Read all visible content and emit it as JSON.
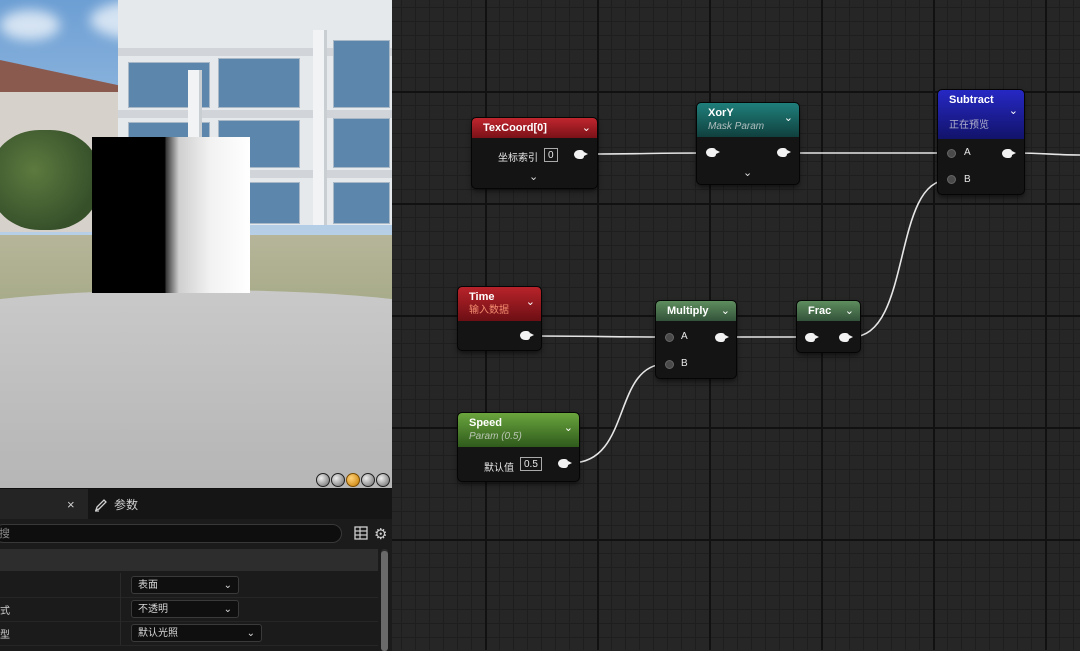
{
  "viewport": {
    "preview_buttons": [
      "cylinder",
      "sphere",
      "plane",
      "cube",
      "custom-mesh"
    ],
    "active_preview": "plane"
  },
  "details_panel": {
    "close_tab": "×",
    "params_tab_label": "参数",
    "search_placeholder": "搜",
    "properties": [
      {
        "label": "",
        "value": "表面"
      },
      {
        "label": "式",
        "value": "不透明"
      },
      {
        "label": "型",
        "value": "默认光照"
      }
    ]
  },
  "graph": {
    "nodes": {
      "texcoord": {
        "title": "TexCoord[0]",
        "pin_label": "坐标索引",
        "value": "0",
        "color": "#b0232c"
      },
      "xory": {
        "title": "XorY",
        "subtitle": "Mask Param",
        "color": "#1c6f6c"
      },
      "subtract": {
        "title": "Subtract",
        "subtitle": "正在预览",
        "pin_a": "A",
        "pin_b": "B",
        "color": "#1d1fa6"
      },
      "time": {
        "title": "Time",
        "subtitle": "输入数据",
        "color": "#a91f25"
      },
      "multiply": {
        "title": "Multiply",
        "pin_a": "A",
        "pin_b": "B",
        "color": "#4c7a4c"
      },
      "frac": {
        "title": "Frac",
        "color": "#4c7a4c"
      },
      "speed": {
        "title": "Speed",
        "subtitle": "Param (0.5)",
        "pin_label": "默认值",
        "value": "0.5",
        "color": "#4e8a2e"
      }
    }
  }
}
